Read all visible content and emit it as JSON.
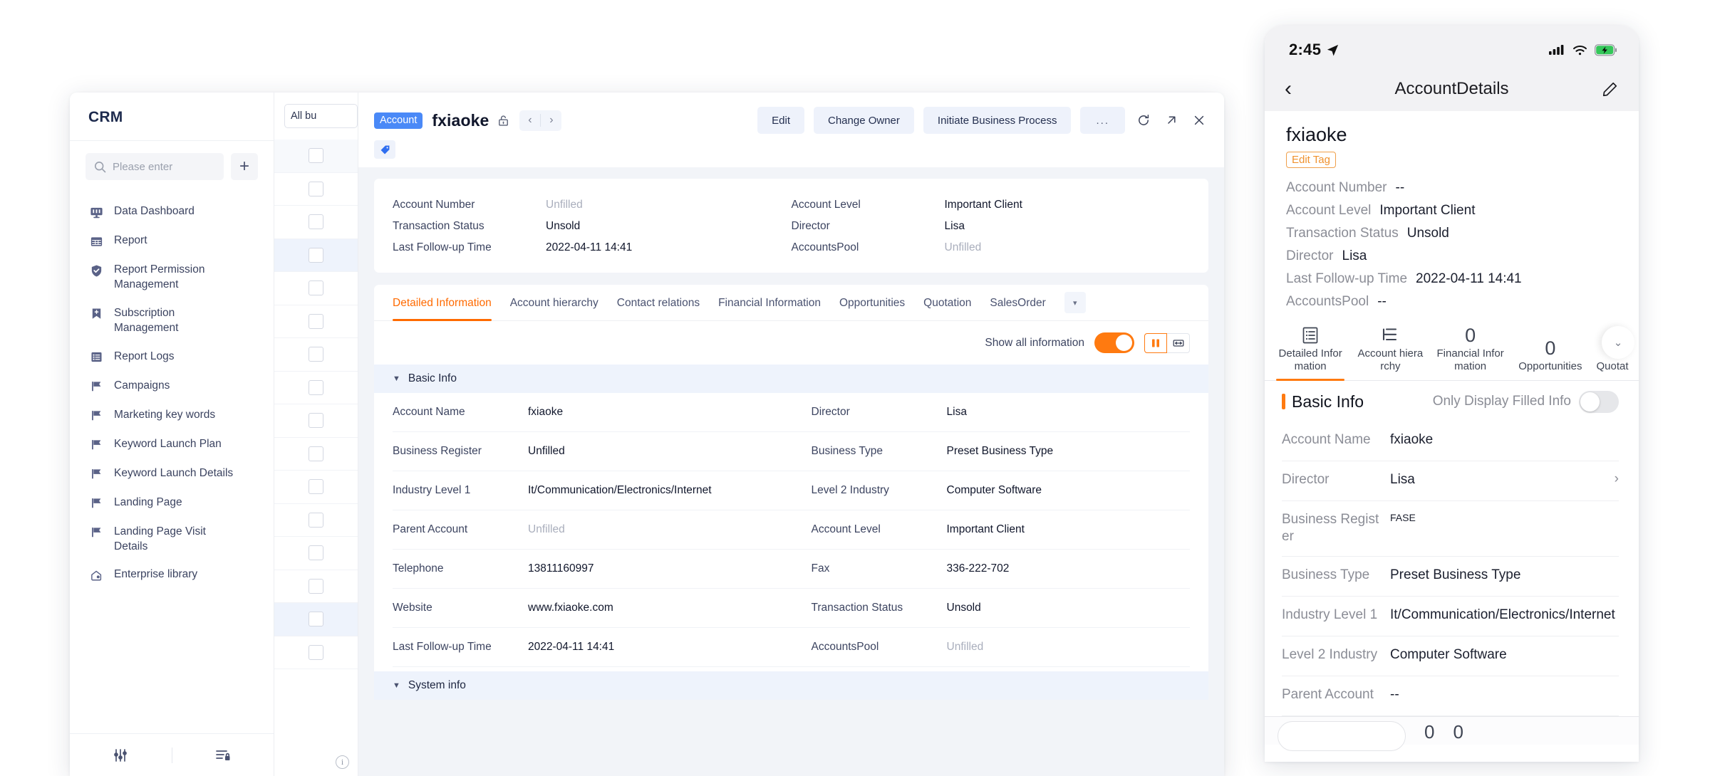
{
  "sidebar": {
    "title": "CRM",
    "search_placeholder": "Please enter",
    "add_label": "+",
    "items": [
      {
        "label": "Data Dashboard",
        "icon": "dashboard-icon"
      },
      {
        "label": "Report",
        "icon": "table-icon"
      },
      {
        "label": "Report Permission Management",
        "icon": "shield-check-icon"
      },
      {
        "label": "Subscription Management",
        "icon": "bookmark-plus-icon"
      },
      {
        "label": "Report Logs",
        "icon": "list-icon"
      },
      {
        "label": "Campaigns",
        "icon": "flag-icon"
      },
      {
        "label": "Marketing key words",
        "icon": "flag-icon"
      },
      {
        "label": "Keyword Launch Plan",
        "icon": "flag-icon"
      },
      {
        "label": "Keyword Launch Details",
        "icon": "flag-icon"
      },
      {
        "label": "Landing Page",
        "icon": "flag-icon"
      },
      {
        "label": "Landing Page Visit Details",
        "icon": "flag-icon"
      },
      {
        "label": "Enterprise library",
        "icon": "home-gear-icon"
      }
    ],
    "footer": [
      {
        "icon": "sliders-icon"
      },
      {
        "icon": "list-lock-icon"
      }
    ]
  },
  "list_strip": {
    "filter_label": "All bu",
    "rows": 16,
    "info_glyph": "i"
  },
  "detail": {
    "record_type_tag": "Account",
    "record_name": "fxiaoke",
    "lock_icon": "unlock-icon",
    "prev_icon": "chevron-left-icon",
    "next_icon": "chevron-right-icon",
    "actions": [
      {
        "label": "Edit"
      },
      {
        "label": "Change Owner"
      },
      {
        "label": "Initiate Business Process"
      },
      {
        "label": "..."
      }
    ],
    "window_icons": [
      {
        "name": "refresh-icon"
      },
      {
        "name": "popout-icon"
      },
      {
        "name": "close-icon"
      }
    ],
    "tag_icon": "blue-tag-icon",
    "summary": [
      [
        {
          "key": "Account Number",
          "value": "Unfilled",
          "empty": true
        },
        {
          "key": "Account Level",
          "value": "Important Client",
          "empty": false
        }
      ],
      [
        {
          "key": "Transaction Status",
          "value": "Unsold",
          "empty": false
        },
        {
          "key": "Director",
          "value": "Lisa",
          "empty": false
        }
      ],
      [
        {
          "key": "Last Follow-up Time",
          "value": "2022-04-11 14:41",
          "empty": false
        },
        {
          "key": "AccountsPool",
          "value": "Unfilled",
          "empty": true
        }
      ]
    ],
    "tabs": [
      {
        "label": "Detailed Information",
        "active": true
      },
      {
        "label": "Account hierarchy",
        "active": false
      },
      {
        "label": "Contact relations",
        "active": false
      },
      {
        "label": "Financial Information",
        "active": false
      },
      {
        "label": "Opportunities",
        "active": false
      },
      {
        "label": "Quotation",
        "active": false
      },
      {
        "label": "SalesOrder",
        "active": false
      }
    ],
    "tab_more_icon": "chevron-down-icon",
    "toolbar": {
      "show_all_label": "Show all information",
      "show_all_on": true,
      "seg_left_icon": "two-column-icon",
      "seg_right_icon": "expand-width-icon"
    },
    "sections": [
      {
        "title": "Basic Info",
        "rows": [
          [
            {
              "key": "Account Name",
              "value": "fxiaoke",
              "empty": false
            },
            {
              "key": "Director",
              "value": "Lisa",
              "empty": false
            }
          ],
          [
            {
              "key": "Business Register",
              "value": "Unfilled",
              "empty": false
            },
            {
              "key": "Business Type",
              "value": "Preset Business Type",
              "empty": false
            }
          ],
          [
            {
              "key": "Industry Level 1",
              "value": "It/Communication/Electronics/Internet",
              "empty": false
            },
            {
              "key": "Level 2 Industry",
              "value": "Computer Software",
              "empty": false
            }
          ],
          [
            {
              "key": "Parent Account",
              "value": "Unfilled",
              "empty": true
            },
            {
              "key": "Account Level",
              "value": "Important Client",
              "empty": false
            }
          ],
          [
            {
              "key": "Telephone",
              "value": "13811160997",
              "empty": false
            },
            {
              "key": "Fax",
              "value": "336-222-702",
              "empty": false
            }
          ],
          [
            {
              "key": "Website",
              "value": "www.fxiaoke.com",
              "empty": false
            },
            {
              "key": "Transaction Status",
              "value": "Unsold",
              "empty": false
            }
          ],
          [
            {
              "key": "Last Follow-up Time",
              "value": "2022-04-11 14:41",
              "empty": false
            },
            {
              "key": "AccountsPool",
              "value": "Unfilled",
              "empty": true
            }
          ]
        ]
      },
      {
        "title": "System info",
        "rows": []
      }
    ]
  },
  "phone": {
    "status": {
      "time": "2:45",
      "location_icon": "location-arrow-icon",
      "signal_icon": "cellular-signal-icon",
      "wifi_icon": "wifi-icon",
      "battery_icon": "battery-charging-icon"
    },
    "nav": {
      "back_icon": "chevron-left-icon",
      "title": "AccountDetails",
      "edit_icon": "pencil-icon"
    },
    "record_name": "fxiaoke",
    "tag_label": "Edit Tag",
    "summary": [
      {
        "key": "Account Number",
        "value": "--"
      },
      {
        "key": "Account Level",
        "value": "Important Client"
      },
      {
        "key": "Transaction Status",
        "value": "Unsold"
      },
      {
        "key": "Director",
        "value": "Lisa"
      },
      {
        "key": "Last Follow-up Time",
        "value": "2022-04-11 14:41"
      },
      {
        "key": "AccountsPool",
        "value": "--"
      }
    ],
    "tabs": [
      {
        "label": "Detailed Information",
        "icon": "document-list-icon",
        "count": null,
        "active": true
      },
      {
        "label": "Account hierarchy",
        "icon": "hierarchy-icon",
        "count": null,
        "active": false
      },
      {
        "label": "Financial Information",
        "icon": null,
        "count": "0",
        "active": false
      },
      {
        "label": "Opportunities",
        "icon": null,
        "count": "0",
        "active": false
      },
      {
        "label": "Quotat",
        "icon": null,
        "count": null,
        "active": false
      }
    ],
    "tabs_chevron_icon": "chevron-down-icon",
    "section": {
      "title": "Basic Info",
      "only_filled_label": "Only Display Filled Info",
      "only_filled_on": false
    },
    "fields": [
      {
        "key": "Account Name",
        "value": "fxiaoke",
        "chevron": false,
        "small": false
      },
      {
        "key": "Director",
        "value": "Lisa",
        "chevron": true,
        "small": false
      },
      {
        "key": "Business Register",
        "value": "FASE",
        "chevron": false,
        "small": true
      },
      {
        "key": "Business Type",
        "value": "Preset Business Type",
        "chevron": false,
        "small": false
      },
      {
        "key": "Industry Level 1",
        "value": "It/Communication/Electronics/Internet",
        "chevron": false,
        "small": false
      },
      {
        "key": "Level 2 Industry",
        "value": "Computer Software",
        "chevron": false,
        "small": false
      },
      {
        "key": "Parent Account",
        "value": "--",
        "chevron": false,
        "small": false
      }
    ],
    "bottom_counts": [
      "0",
      "0"
    ]
  },
  "colors": {
    "accent_orange": "#ff7a10",
    "tag_blue": "#4a89f7",
    "section_bg": "#eef3fc"
  }
}
